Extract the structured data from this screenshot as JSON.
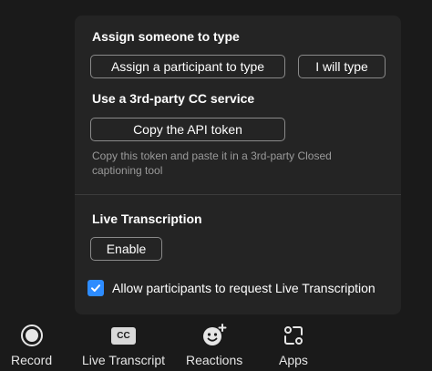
{
  "panel": {
    "assign_title": "Assign someone to type",
    "assign_participant_label": "Assign a participant to type",
    "i_will_type_label": "I will type",
    "third_party_title": "Use a 3rd-party CC service",
    "copy_token_label": "Copy the API token",
    "copy_token_hint": "Copy this token and paste it in a 3rd-party Closed captioning tool",
    "live_title": "Live Transcription",
    "enable_label": "Enable",
    "allow_request_label": "Allow participants to request Live Transcription",
    "allow_request_checked": true
  },
  "toolbar": {
    "items": [
      {
        "label": "Record",
        "icon": "record-icon"
      },
      {
        "label": "Live Transcript",
        "icon": "cc-icon",
        "badge": "CC"
      },
      {
        "label": "Reactions",
        "icon": "reactions-icon"
      },
      {
        "label": "Apps",
        "icon": "apps-icon"
      }
    ]
  },
  "colors": {
    "panel_bg": "#242424",
    "page_bg": "#1a1a1a",
    "checkbox_accent": "#2d8cff",
    "hint_text": "#9a9a9a"
  }
}
